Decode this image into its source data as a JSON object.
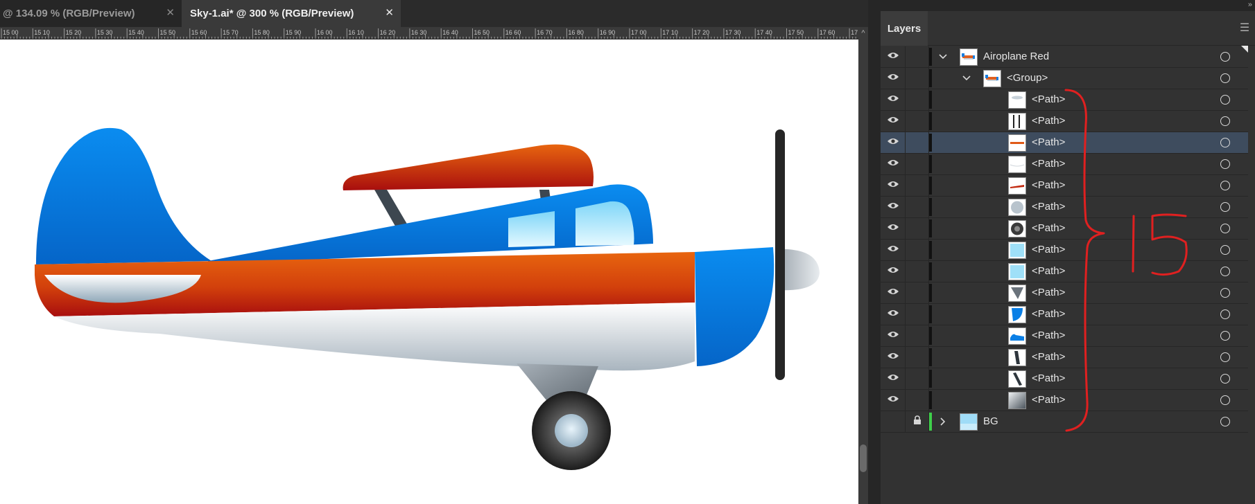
{
  "tabs": [
    {
      "label": "@ 134.09 % (RGB/Preview)",
      "close": "✕",
      "active": false
    },
    {
      "label": "Sky-1.ai* @ 300 % (RGB/Preview)",
      "close": "✕",
      "active": true
    }
  ],
  "ruler": {
    "labels": [
      "15 00",
      "15 10",
      "15 20",
      "15 30",
      "15 40",
      "15 50",
      "15 60",
      "15 70",
      "15 80",
      "15 90",
      "16 00",
      "16 10",
      "16 20",
      "16 30",
      "16 40",
      "16 50",
      "16 60",
      "16 70",
      "16 80",
      "16 90",
      "17 00",
      "17 10",
      "17 20",
      "17 30",
      "17 40",
      "17 50",
      "17 60",
      "17"
    ],
    "corner": "^"
  },
  "panel": {
    "tab": "Layers",
    "collapse": "»",
    "menu": "☰"
  },
  "layers": [
    {
      "name": "Airoplane Red",
      "eye": true,
      "locked": false,
      "expanded": true,
      "kind": "layer",
      "thumb": "plane-thumbnail",
      "selected": false
    },
    {
      "name": "<Group>",
      "eye": true,
      "locked": false,
      "expanded": true,
      "kind": "group",
      "thumb": "plane-thumbnail",
      "selected": false
    },
    {
      "name": "<Path>",
      "eye": true,
      "locked": false,
      "kind": "path",
      "thumb": "wing-light",
      "selected": false
    },
    {
      "name": "<Path>",
      "eye": true,
      "locked": false,
      "kind": "path",
      "thumb": "window-split",
      "selected": false
    },
    {
      "name": "<Path>",
      "eye": true,
      "locked": false,
      "kind": "path",
      "thumb": "orange-stripe",
      "selected": true
    },
    {
      "name": "<Path>",
      "eye": true,
      "locked": false,
      "kind": "path",
      "thumb": "white-curve",
      "selected": false
    },
    {
      "name": "<Path>",
      "eye": true,
      "locked": false,
      "kind": "path",
      "thumb": "red-wing",
      "selected": false
    },
    {
      "name": "<Path>",
      "eye": true,
      "locked": false,
      "kind": "path",
      "thumb": "grey-circle",
      "selected": false
    },
    {
      "name": "<Path>",
      "eye": true,
      "locked": false,
      "kind": "path",
      "thumb": "dark-circle",
      "selected": false
    },
    {
      "name": "<Path>",
      "eye": true,
      "locked": false,
      "kind": "path",
      "thumb": "window-pane",
      "selected": false
    },
    {
      "name": "<Path>",
      "eye": true,
      "locked": false,
      "kind": "path",
      "thumb": "window-pane",
      "selected": false
    },
    {
      "name": "<Path>",
      "eye": true,
      "locked": false,
      "kind": "path",
      "thumb": "strut-triangle",
      "selected": false
    },
    {
      "name": "<Path>",
      "eye": true,
      "locked": false,
      "kind": "path",
      "thumb": "blue-nose",
      "selected": false
    },
    {
      "name": "<Path>",
      "eye": true,
      "locked": false,
      "kind": "path",
      "thumb": "blue-tail",
      "selected": false
    },
    {
      "name": "<Path>",
      "eye": true,
      "locked": false,
      "kind": "path",
      "thumb": "dark-strut",
      "selected": false
    },
    {
      "name": "<Path>",
      "eye": true,
      "locked": false,
      "kind": "path",
      "thumb": "dark-strut-2",
      "selected": false
    },
    {
      "name": "<Path>",
      "eye": true,
      "locked": false,
      "kind": "path",
      "thumb": "grey-gradient",
      "selected": false
    },
    {
      "name": "BG",
      "eye": false,
      "locked": true,
      "expanded": false,
      "kind": "layer",
      "thumb": "sky-thumbnail",
      "selected": false,
      "color": "#3ecf4a"
    }
  ],
  "annotation": {
    "text": "15",
    "color": "#e02020"
  },
  "colors": {
    "plane_blue": "#0a7fe6",
    "plane_orange": "#e85a10",
    "plane_red": "#b81a0a",
    "selection": "#3e4c5e"
  }
}
